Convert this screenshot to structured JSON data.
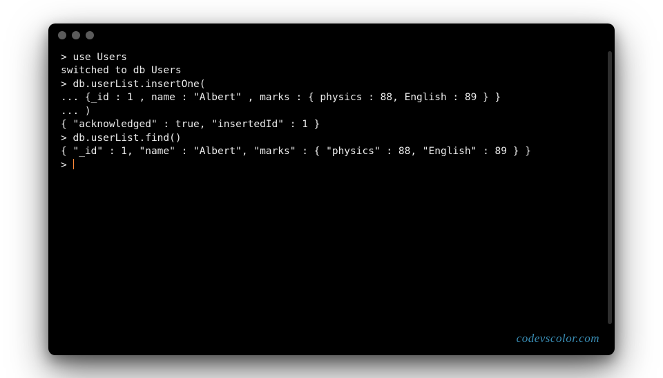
{
  "terminal": {
    "lines": [
      "> use Users",
      "switched to db Users",
      "> db.userList.insertOne(",
      "... {_id : 1 , name : \"Albert\" , marks : { physics : 88, English : 89 } }",
      "... )",
      "{ \"acknowledged\" : true, \"insertedId\" : 1 }",
      "> db.userList.find()",
      "{ \"_id\" : 1, \"name\" : \"Albert\", \"marks\" : { \"physics\" : 88, \"English\" : 89 } }"
    ],
    "prompt_last": "> "
  },
  "watermark": "codevscolor.com"
}
